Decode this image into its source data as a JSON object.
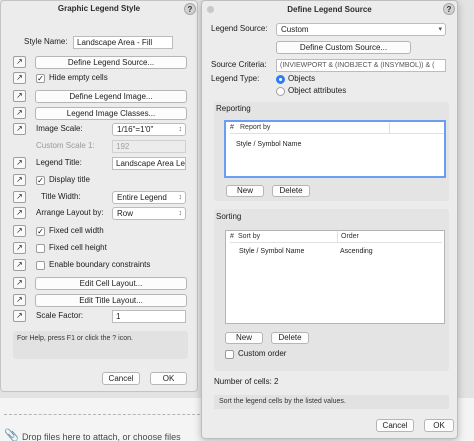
{
  "background": {
    "drop_text": "Drop files here to attach, or choose files"
  },
  "left_dialog": {
    "title": "Graphic Legend Style",
    "help_label": "?",
    "style_name_label": "Style Name:",
    "style_name_value": "Landscape Area - Fill",
    "define_legend_source_label": "Define Legend Source...",
    "hide_empty_cells_label": "Hide empty cells",
    "define_legend_image_label": "Define Legend Image...",
    "legend_image_classes_label": "Legend Image Classes...",
    "image_scale_label": "Image Scale:",
    "image_scale_value": "1/16\"=1'0\"",
    "custom_scale_label": "Custom Scale 1:",
    "custom_scale_value": "192",
    "legend_title_label": "Legend Title:",
    "legend_title_value": "Landscape Area Leg",
    "display_title_label": "Display title",
    "title_width_label": "Title Width:",
    "title_width_value": "Entire Legend",
    "arrange_layout_label": "Arrange Layout by:",
    "arrange_layout_value": "Row",
    "fixed_cell_width_label": "Fixed cell width",
    "fixed_cell_height_label": "Fixed cell height",
    "boundary_label": "Enable boundary constraints",
    "edit_cell_layout_label": "Edit Cell Layout...",
    "edit_title_layout_label": "Edit Title Layout...",
    "scale_factor_label": "Scale Factor:",
    "scale_factor_value": "1",
    "help_text": "For Help, press F1 or click the ? icon.",
    "cancel_label": "Cancel",
    "ok_label": "OK"
  },
  "right_dialog": {
    "title": "Define Legend Source",
    "help_label": "?",
    "legend_source_label": "Legend Source:",
    "legend_source_value": "Custom",
    "define_custom_source_label": "Define Custom Source...",
    "source_criteria_label": "Source Criteria:",
    "source_criteria_value": "(INVIEWPORT & (INOBJECT & (INSYMBOL)) & (",
    "legend_type_label": "Legend Type:",
    "objects_label": "Objects",
    "object_attributes_label": "Object attributes",
    "reporting_label": "Reporting",
    "reporting_columns": [
      "#",
      "Report by"
    ],
    "reporting_rows": [
      [
        "",
        "Style / Symbol Name"
      ]
    ],
    "new_label": "New",
    "delete_label": "Delete",
    "sorting_label": "Sorting",
    "sorting_columns": [
      "#",
      "Sort by",
      "Order"
    ],
    "sorting_rows": [
      [
        "",
        "Style / Symbol Name",
        "Ascending"
      ]
    ],
    "custom_order_label": "Custom order",
    "cells_label": "Number of cells:",
    "cells_value": "2",
    "info_text": "Sort the legend cells by the listed values.",
    "cancel_label": "Cancel",
    "ok_label": "OK",
    "accent_color": "#2f7cf6"
  }
}
